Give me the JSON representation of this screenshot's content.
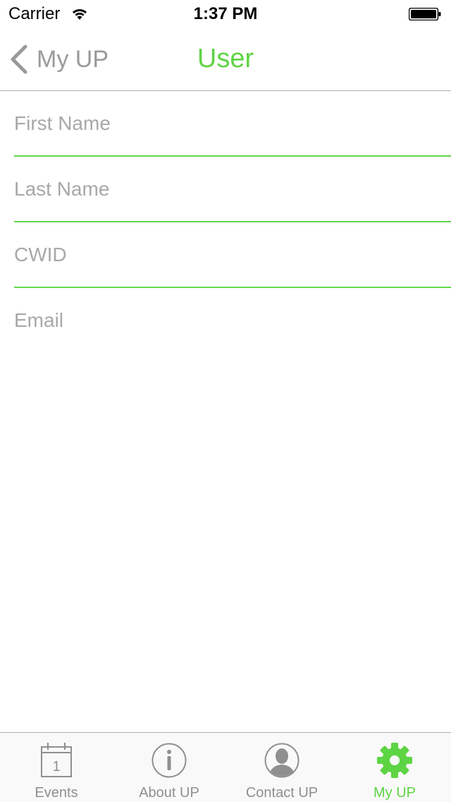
{
  "status_bar": {
    "carrier": "Carrier",
    "time": "1:37 PM"
  },
  "nav_bar": {
    "back_label": "My UP",
    "title": "User"
  },
  "form": {
    "first_name": {
      "placeholder": "First Name",
      "value": ""
    },
    "last_name": {
      "placeholder": "Last Name",
      "value": ""
    },
    "cwid": {
      "placeholder": "CWID",
      "value": ""
    },
    "email": {
      "placeholder": "Email",
      "value": ""
    }
  },
  "tab_bar": {
    "items": [
      {
        "label": "Events",
        "icon": "calendar-icon",
        "day": "1"
      },
      {
        "label": "About UP",
        "icon": "info-icon"
      },
      {
        "label": "Contact UP",
        "icon": "person-icon"
      },
      {
        "label": "My UP",
        "icon": "gear-icon"
      }
    ],
    "selected": "My UP"
  },
  "colors": {
    "accent": "#5dd443",
    "inactive": "#8f8f8f",
    "placeholder": "#a8a8a8",
    "separator": "#b2b2b2"
  }
}
